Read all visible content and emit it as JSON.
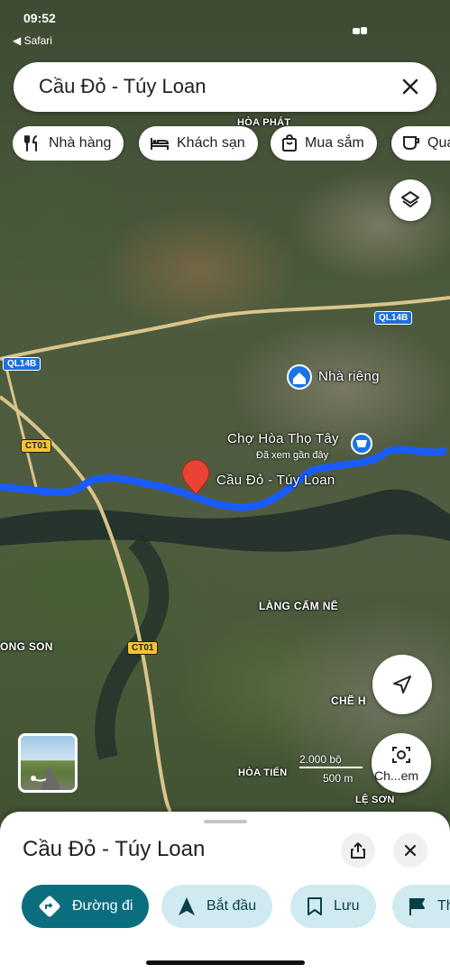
{
  "status": {
    "time": "09:52",
    "back_app": "◀ Safari"
  },
  "search": {
    "query": "Cầu Đỏ - Túy Loan"
  },
  "chips": [
    {
      "label": "Nhà hàng",
      "icon": "fork-knife-icon"
    },
    {
      "label": "Khách sạn",
      "icon": "bed-icon"
    },
    {
      "label": "Mua sắm",
      "icon": "shopping-bag-icon"
    },
    {
      "label": "Quán cà phê",
      "icon": "coffee-cup-icon"
    }
  ],
  "map": {
    "labels": {
      "hoa_phat": "HÒA PHÁT",
      "nha_rieng": "Nhà riêng",
      "cho_hoa_tho_tay": "Chợ Hòa Thọ Tây",
      "recently_viewed": "Đã xem gần đây",
      "cau_do_tuy_loan": "Cầu Đỏ - Túy Loan",
      "lang_cam_ne": "LÀNG CẨM NÊ",
      "ong_son": "ONG SON",
      "che_h": "CHẼ H",
      "hoa_tien": "HÒA TIẾN",
      "le_son": "LỆ SƠN"
    },
    "shields": {
      "ql14b_right": "QL14B",
      "ql14b_left": "QL14B",
      "ct01_top": "CT01",
      "ct01_bottom": "CT01"
    },
    "colors": {
      "route": "#1a5cff",
      "pin": "#ea4335",
      "place_pin": "#1a73e8"
    }
  },
  "scale": {
    "feet": "2.000 bộ",
    "meters": "500 m"
  },
  "camera": {
    "label": "Ch...em"
  },
  "sheet": {
    "title": "Cầu Đỏ - Túy Loan",
    "actions": [
      {
        "label": "Đường đi",
        "icon": "directions-icon",
        "style": "primary"
      },
      {
        "label": "Bắt đầu",
        "icon": "navigation-arrow-icon",
        "style": "secondary"
      },
      {
        "label": "Lưu",
        "icon": "bookmark-icon",
        "style": "secondary"
      },
      {
        "label": "Thêm nhãn",
        "icon": "flag-icon",
        "style": "secondary"
      }
    ]
  }
}
